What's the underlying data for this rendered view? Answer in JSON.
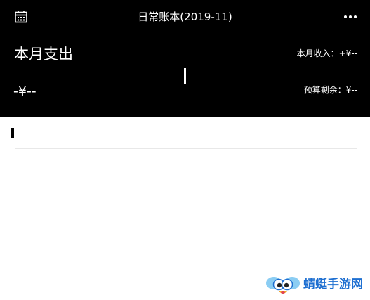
{
  "header": {
    "title": "日常账本(2019-11)",
    "calendar_icon": "calendar-icon",
    "more_icon": "more-horizontal-icon",
    "monthly_expense_label": "本月支出",
    "monthly_expense_value": "-¥--",
    "monthly_income_label": "本月收入：",
    "monthly_income_value": "+¥--",
    "budget_remaining_label": "预算剩余：",
    "budget_remaining_value": "¥--"
  },
  "watermark": {
    "text": "蜻蜓手游网",
    "icon": "dragonfly-mascot-logo"
  },
  "colors": {
    "header_bg": "#000000",
    "header_text": "#ffffff",
    "body_bg": "#ffffff",
    "watermark_text": "#1e6fd1"
  }
}
